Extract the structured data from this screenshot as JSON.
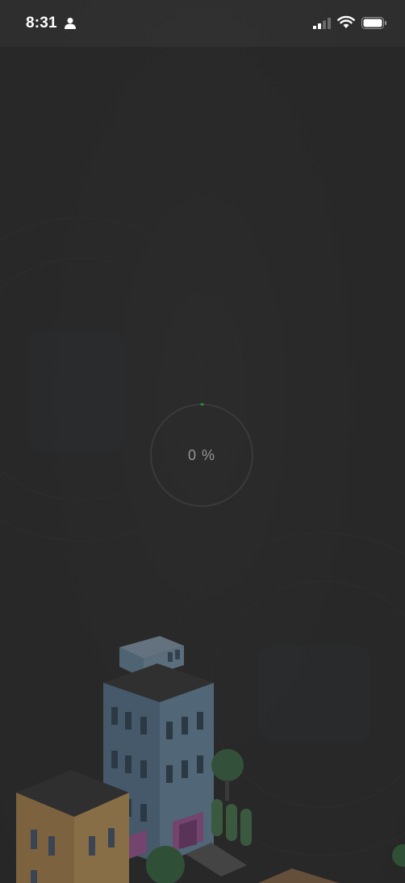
{
  "status_bar": {
    "time": "8:31",
    "icons": [
      "person-icon",
      "signal-icon",
      "wifi-icon",
      "battery-icon"
    ]
  },
  "loader": {
    "progress_text": "0 %",
    "progress_value": 0,
    "ring_color": "#4a4a4a",
    "accent_color": "#2ecc40"
  },
  "colors": {
    "background": "#2f2f2f",
    "status_text": "#ffffff"
  }
}
